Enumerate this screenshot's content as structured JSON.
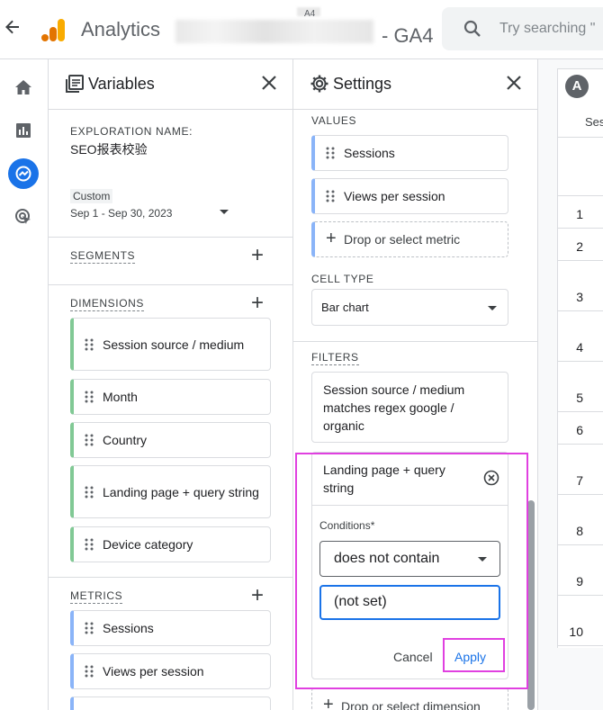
{
  "topbar": {
    "app_title": "Analytics",
    "property_suffix": "- GA4",
    "property_small": "A4",
    "search_placeholder": "Try searching \""
  },
  "variables": {
    "title": "Variables",
    "exploration_label": "EXPLORATION NAME:",
    "exploration_name": "SEO报表校验",
    "date_badge": "Custom",
    "date_range": "Sep 1 - Sep 30, 2023",
    "segments_label": "SEGMENTS",
    "dimensions_label": "DIMENSIONS",
    "dimensions": [
      "Session source / medium",
      "Month",
      "Country",
      "Landing page + query string",
      "Device category"
    ],
    "metrics_label": "METRICS",
    "metrics": [
      "Sessions",
      "Views per session",
      ""
    ]
  },
  "settings": {
    "title": "Settings",
    "values_label": "VALUES",
    "values": [
      "Sessions",
      "Views per session"
    ],
    "drop_metric": "Drop or select metric",
    "cell_type_label": "CELL TYPE",
    "cell_type_value": "Bar chart",
    "filters_label": "FILTERS",
    "filter1": "Session source / medium matches regex google / organic",
    "filter2_title": "Landing page + query string",
    "conditions_label": "Conditions*",
    "condition_value": "does not contain",
    "condition_input": "(not set)",
    "cancel": "Cancel",
    "apply": "Apply",
    "drop_dimension": "Drop or select dimension"
  },
  "table": {
    "tab": "A",
    "header": "Ses",
    "rows": [
      "1",
      "2",
      "3",
      "4",
      "5",
      "6",
      "7",
      "8",
      "9",
      "10"
    ]
  },
  "colors": {
    "accent": "#1a73e8",
    "dimension_bar": "#81c995",
    "metric_bar": "#8ab4f8",
    "highlight": "#e040e0"
  }
}
